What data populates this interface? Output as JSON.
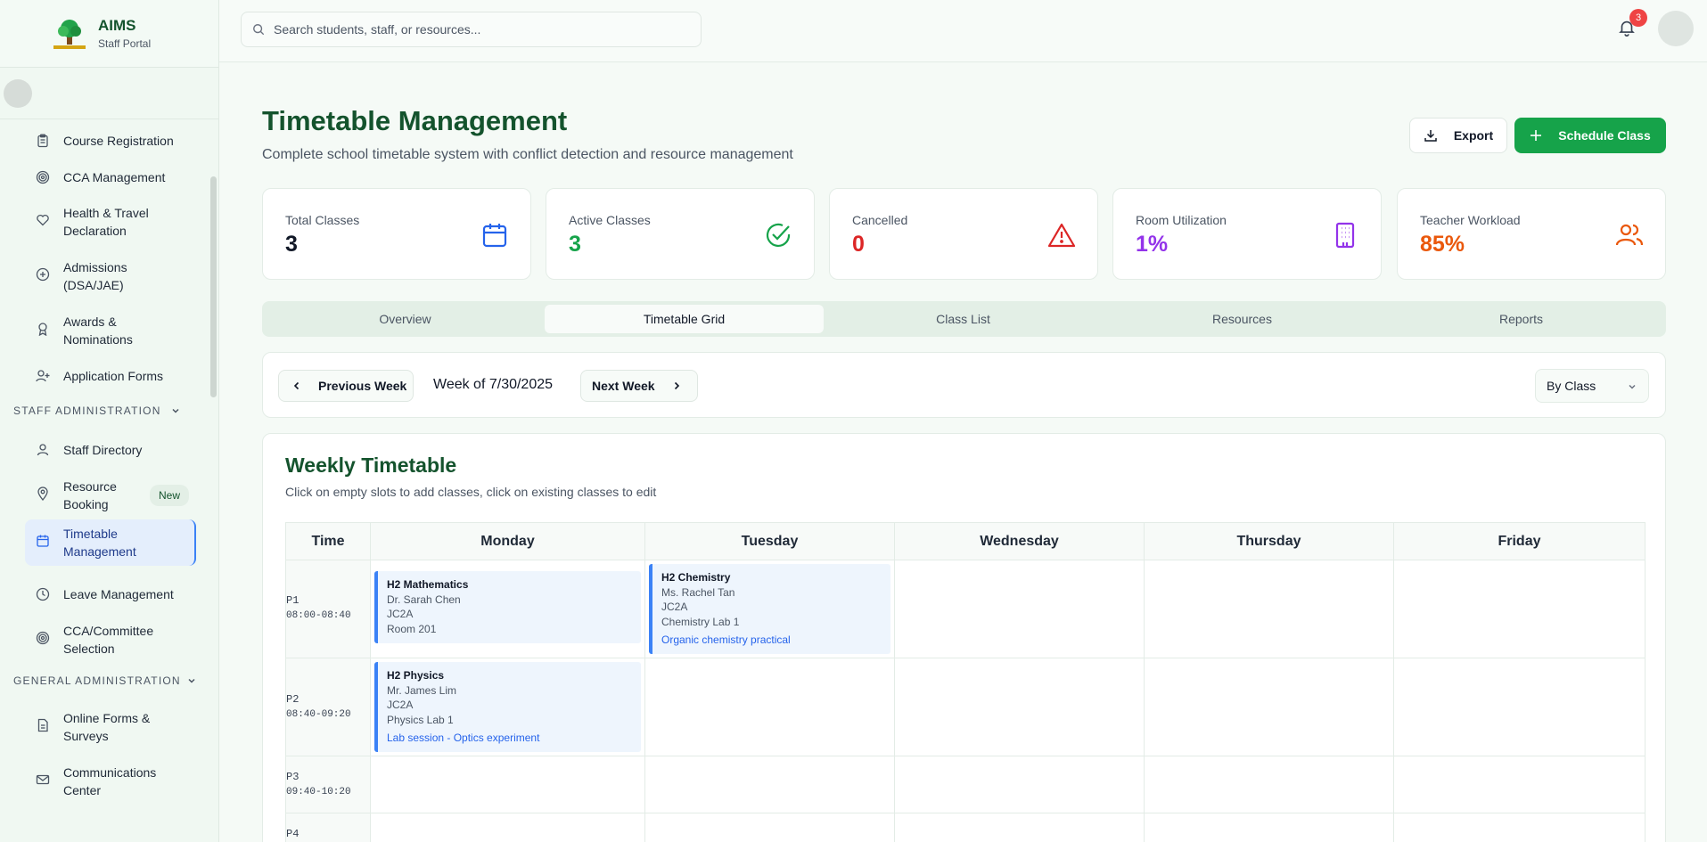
{
  "brand": {
    "title": "AIMS",
    "subtitle": "Staff Portal"
  },
  "sidebar": {
    "items": [
      {
        "label": "Course Registration",
        "icon": "clipboard-icon"
      },
      {
        "label": "CCA Management",
        "icon": "target-icon"
      },
      {
        "label": "Health & Travel Declaration",
        "icon": "heart-icon"
      },
      {
        "label": "Admissions (DSA/JAE)",
        "icon": "plus-circle-icon"
      },
      {
        "label": "Awards & Nominations",
        "icon": "award-icon"
      },
      {
        "label": "Application Forms",
        "icon": "user-plus-icon"
      },
      {
        "label": "Staff Directory",
        "icon": "users-icon"
      },
      {
        "label": "Resource Booking",
        "icon": "map-pin-icon",
        "badge": "New"
      },
      {
        "label": "Timetable Management",
        "icon": "calendar-icon",
        "active": true
      },
      {
        "label": "Leave Management",
        "icon": "clock-icon"
      },
      {
        "label": "CCA/Committee Selection",
        "icon": "target-icon"
      },
      {
        "label": "Online Forms & Surveys",
        "icon": "file-icon"
      },
      {
        "label": "Communications Center",
        "icon": "mail-icon"
      }
    ],
    "sections": {
      "staff": "STAFF ADMINISTRATION",
      "general": "GENERAL ADMINISTRATION"
    }
  },
  "topbar": {
    "search_placeholder": "Search students, staff, or resources...",
    "notification_count": "3"
  },
  "header": {
    "title": "Timetable Management",
    "subtitle": "Complete school timetable system with conflict detection and resource management",
    "export_label": "Export",
    "schedule_label": "Schedule Class"
  },
  "stats": [
    {
      "label": "Total Classes",
      "value": "3",
      "color": "#111827",
      "icon": "calendar-icon"
    },
    {
      "label": "Active Classes",
      "value": "3",
      "color": "#16a34a",
      "icon": "check-circle-icon"
    },
    {
      "label": "Cancelled",
      "value": "0",
      "color": "#dc2626",
      "icon": "alert-triangle-icon"
    },
    {
      "label": "Room Utilization",
      "value": "1%",
      "color": "#9333ea",
      "icon": "building-icon"
    },
    {
      "label": "Teacher Workload",
      "value": "85%",
      "color": "#ea580c",
      "icon": "users-icon"
    }
  ],
  "tabs": [
    "Overview",
    "Timetable Grid",
    "Class List",
    "Resources",
    "Reports"
  ],
  "weekbar": {
    "prev": "Previous Week",
    "week": "Week of 7/30/2025",
    "next": "Next Week",
    "view": "By Class"
  },
  "timetable": {
    "title": "Weekly Timetable",
    "subtitle": "Click on empty slots to add classes, click on existing classes to edit",
    "headers": [
      "Time",
      "Monday",
      "Tuesday",
      "Wednesday",
      "Thursday",
      "Friday"
    ],
    "periods": [
      {
        "label": "P1",
        "time": "08:00-08:40"
      },
      {
        "label": "P2",
        "time": "08:40-09:20"
      },
      {
        "label": "P3",
        "time": "09:40-10:20"
      },
      {
        "label": "P4",
        "time": ""
      }
    ],
    "classes": {
      "p1_mon": {
        "subject": "H2 Mathematics",
        "teacher": "Dr. Sarah Chen",
        "class": "JC2A",
        "room": "Room 201"
      },
      "p1_tue": {
        "subject": "H2 Chemistry",
        "teacher": "Ms. Rachel Tan",
        "class": "JC2A",
        "room": "Chemistry Lab 1",
        "note": "Organic chemistry practical"
      },
      "p2_mon": {
        "subject": "H2 Physics",
        "teacher": "Mr. James Lim",
        "class": "JC2A",
        "room": "Physics Lab 1",
        "note": "Lab session - Optics experiment"
      }
    }
  }
}
